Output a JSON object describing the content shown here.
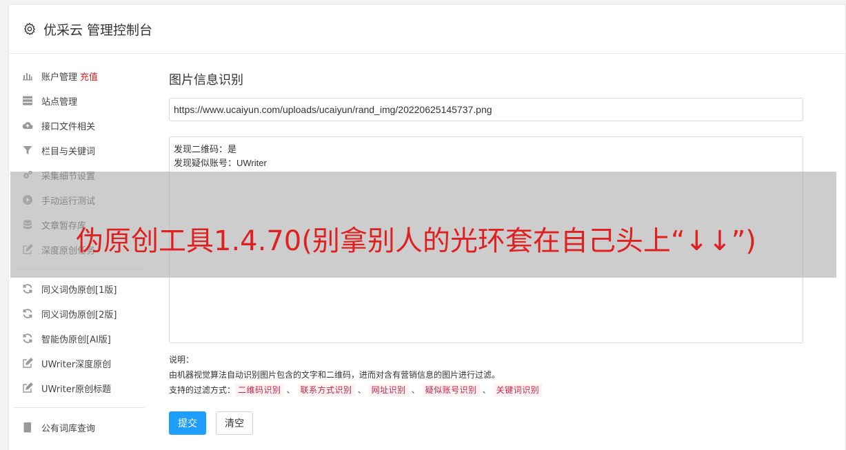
{
  "header": {
    "title": "优采云 管理控制台"
  },
  "sidebar": {
    "group1": [
      {
        "label": "账户管理",
        "badge": "充值",
        "icon": "bar-chart-icon"
      },
      {
        "label": "站点管理",
        "icon": "server-icon"
      },
      {
        "label": "接口文件相关",
        "icon": "cloud-upload-icon"
      },
      {
        "label": "栏目与关键词",
        "icon": "filter-icon"
      },
      {
        "label": "采集细节设置",
        "icon": "gears-icon"
      },
      {
        "label": "手动运行测试",
        "icon": "play-circle-icon"
      },
      {
        "label": "文章暂存库",
        "icon": "database-icon"
      },
      {
        "label": "深度原创任务",
        "icon": "edit-icon"
      }
    ],
    "group2": [
      {
        "label": "同义词伪原创[1版]",
        "icon": "refresh-icon"
      },
      {
        "label": "同义词伪原创[2版]",
        "icon": "refresh-icon"
      },
      {
        "label": "智能伪原创[AI版]",
        "icon": "refresh-icon"
      },
      {
        "label": "UWriter深度原创",
        "icon": "edit-icon"
      },
      {
        "label": "UWriter原创标题",
        "icon": "edit-icon"
      }
    ],
    "group3": [
      {
        "label": "公有词库查询",
        "icon": "book-icon"
      }
    ]
  },
  "main": {
    "section_title": "图片信息识别",
    "url_value": "https://www.ucaiyun.com/uploads/ucaiyun/rand_img/20220625145737.png",
    "result_lines": [
      "发现二维码：是",
      "发现疑似账号：UWriter"
    ],
    "notes_label": "说明：",
    "notes_desc": "由机器视觉算法自动识别图片包含的文字和二维码，进而对含有营销信息的图片进行过滤。",
    "filters_label": "支持的过滤方式：",
    "filters": [
      "二维码识别",
      "联系方式识别",
      "网址识别",
      "疑似账号识别",
      "关键词识别"
    ],
    "filter_separator": "、",
    "submit_label": "提交",
    "clear_label": "清空"
  },
  "overlay": {
    "text": "伪原创工具1.4.70(别拿别人的光环套在自己头上“↓↓”)"
  },
  "colors": {
    "accent": "#1e9fff",
    "badge": "#e02020",
    "tag_text": "#c7254e",
    "tag_bg": "#fdf2f2"
  }
}
